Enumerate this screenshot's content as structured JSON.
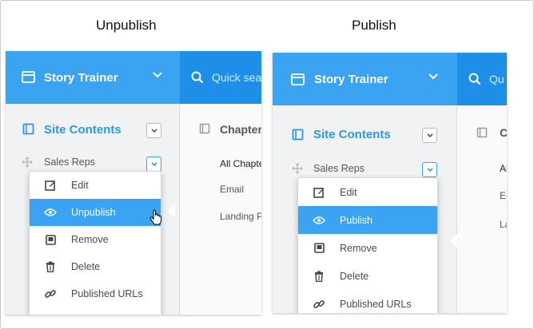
{
  "captions": {
    "left": "Unpublish",
    "right": "Publish"
  },
  "app": {
    "title": "Story Trainer"
  },
  "search": {
    "placeholder_left": "Quick sea",
    "placeholder_right": "Qu"
  },
  "sidebar": {
    "section_title": "Site Contents",
    "item_label": "Sales Reps"
  },
  "main": {
    "left": {
      "heading": "Chapter",
      "rows": [
        "All Chapte",
        "Email",
        "Landing P"
      ]
    },
    "right": {
      "heading": "C",
      "rows": [
        "Al",
        "Er",
        "La"
      ]
    }
  },
  "menu_left": {
    "items": [
      {
        "label": "Edit",
        "icon": "edit-icon"
      },
      {
        "label": "Unpublish",
        "icon": "eye-icon",
        "active": true
      },
      {
        "label": "Remove",
        "icon": "book-icon"
      },
      {
        "label": "Delete",
        "icon": "trash-icon"
      },
      {
        "label": "Published URLs",
        "icon": "link-icon"
      }
    ]
  },
  "menu_right": {
    "items": [
      {
        "label": "Edit",
        "icon": "edit-icon"
      },
      {
        "label": "Publish",
        "icon": "eye-icon",
        "active": true
      },
      {
        "label": "Remove",
        "icon": "book-icon"
      },
      {
        "label": "Delete",
        "icon": "trash-icon"
      },
      {
        "label": "Published URLs",
        "icon": "link-icon"
      }
    ]
  },
  "colors": {
    "accent": "#3aa3f2",
    "accent_dark": "#1e8fe8",
    "link": "#2c98e7"
  }
}
